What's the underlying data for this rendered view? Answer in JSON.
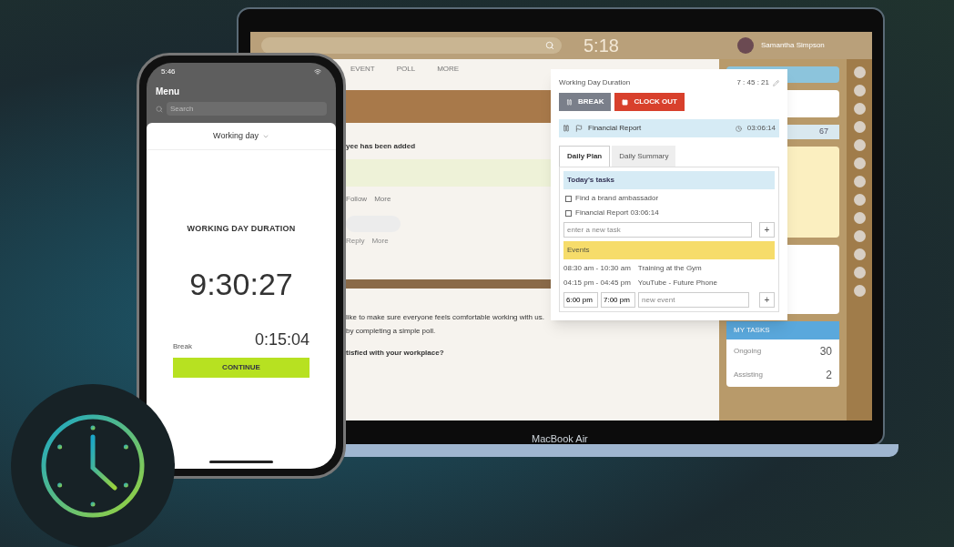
{
  "laptop": {
    "label": "MacBook Air",
    "clock": "5:18",
    "user": "Samantha Simpson",
    "feed_tabs": [
      "EVENT",
      "POLL",
      "MORE"
    ],
    "notice": "yee has been added",
    "post_actions": [
      "Follow",
      "More"
    ],
    "comment_actions": [
      "Reply",
      "More"
    ],
    "post_lines": [
      "like to make sure everyone feels comfortable working with us.",
      "by completing a simple poll."
    ],
    "poll_question": "tisfied with your workplace?",
    "popup": {
      "title": "Working Day Duration",
      "timer": "7 : 45 : 21",
      "buttons": [
        {
          "label": "BREAK",
          "kind": "break"
        },
        {
          "label": "CLOCK OUT",
          "kind": "clockout"
        }
      ],
      "current_task": {
        "name": "Financial Report",
        "time": "03:06:14"
      },
      "tabs": [
        {
          "label": "Daily Plan",
          "selected": true
        },
        {
          "label": "Daily Summary",
          "selected": false
        }
      ],
      "tasks_title": "Today's tasks",
      "tasks": [
        {
          "text": "Find a brand ambassador",
          "checked": false
        },
        {
          "text": "Financial Report 03:06:14",
          "checked": false
        }
      ],
      "task_placeholder": "enter a new task",
      "add": "+",
      "events_title": "Events",
      "events": [
        {
          "time": "08:30 am - 10:30 am",
          "name": "Training at the Gym"
        },
        {
          "time": "04:15 pm - 04:45 pm",
          "name": "YouTube - Future Phone"
        }
      ],
      "event_start": "6:00 pm",
      "event_end": "7:00 pm",
      "event_placeholder": "new event"
    },
    "counter": "67",
    "my_tasks": {
      "title": "MY TASKS",
      "rows": [
        {
          "label": "Ongoing",
          "count": "30"
        },
        {
          "label": "Assisting",
          "count": "2"
        }
      ]
    }
  },
  "phone": {
    "status_time": "5:46",
    "menu": "Menu",
    "search_placeholder": "Search",
    "selector": "Working day",
    "heading": "WORKING DAY DURATION",
    "duration": "9:30:27",
    "break_label": "Break",
    "break_time": "0:15:04",
    "button": "CONTINUE"
  }
}
